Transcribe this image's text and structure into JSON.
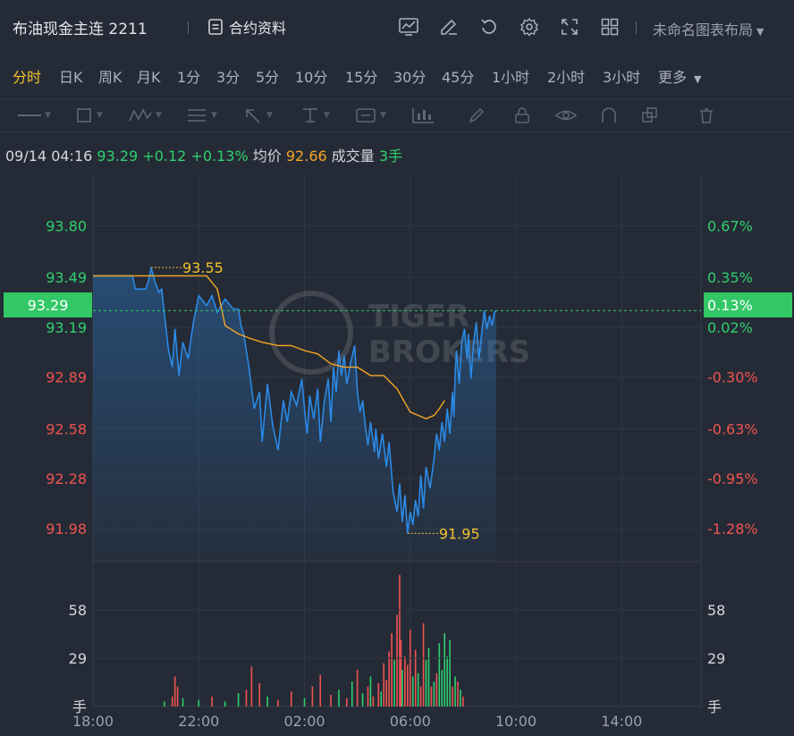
{
  "header": {
    "title": "布油现金主连 2211",
    "info_label": "合约资料",
    "layout_label": "未命名图表布局"
  },
  "periods": [
    "分时",
    "日K",
    "周K",
    "月K",
    "1分",
    "3分",
    "5分",
    "10分",
    "15分",
    "30分",
    "45分",
    "1小时",
    "2小时",
    "3小时",
    "更多"
  ],
  "active_period": "分时",
  "quote": {
    "datetime": "09/14 04:16",
    "price": "93.29",
    "change": "+0.12",
    "change_pct": "+0.13%",
    "avg_label": "均价",
    "avg_value": "92.66",
    "volume_label": "成交量",
    "volume_value": "3手"
  },
  "current_price_badge": "93.29",
  "current_pct_badge": "0.13%",
  "watermark": [
    "TIGER",
    "BROKERS"
  ],
  "colors": {
    "up": "#2fcf6d",
    "down": "#ef5350",
    "price_line": "#2b8ae6",
    "avg_line": "#f5a623",
    "annotation": "#f2c230",
    "active_tab": "#f2c230"
  },
  "chart_data": {
    "type": "line",
    "time_axis": {
      "labels": [
        "18:00",
        "22:00",
        "02:00",
        "06:00",
        "10:00",
        "14:00"
      ],
      "session_start": "18:00",
      "session_hours": 23
    },
    "price_axis": {
      "ticks": [
        "93.80",
        "93.49",
        "93.19",
        "92.89",
        "92.58",
        "92.28",
        "91.98"
      ],
      "pct_ticks": [
        "0.67%",
        "0.35%",
        "0.02%",
        "-0.30%",
        "-0.63%",
        "-0.95%",
        "-1.28%"
      ],
      "prev_close": 93.17,
      "range": [
        91.78,
        94.11
      ]
    },
    "series": [
      {
        "name": "price",
        "x_hours": [
          0,
          1.0,
          1.5,
          1.6,
          2.0,
          2.15,
          2.2,
          2.35,
          2.5,
          2.6,
          2.7,
          2.85,
          3.0,
          3.1,
          3.25,
          3.4,
          3.6,
          3.8,
          4.0,
          4.3,
          4.5,
          4.7,
          5.0,
          5.3,
          5.5,
          5.6,
          5.7,
          5.75,
          5.9,
          6.1,
          6.3,
          6.4,
          6.6,
          6.8,
          7.0,
          7.2,
          7.35,
          7.5,
          7.7,
          7.9,
          8.0,
          8.1,
          8.2,
          8.35,
          8.5,
          8.6,
          8.75,
          8.9,
          9.0,
          9.1,
          9.2,
          9.3,
          9.4,
          9.5,
          9.6,
          9.75,
          9.9,
          10.0,
          10.1,
          10.2,
          10.3,
          10.4,
          10.5,
          10.65,
          10.7,
          10.8,
          10.95,
          11.1,
          11.2,
          11.35,
          11.5,
          11.6,
          11.7,
          11.8,
          11.9,
          12.0,
          12.1,
          12.2,
          12.3,
          12.4,
          12.5,
          12.6,
          12.75,
          12.9,
          13.0,
          13.1,
          13.2,
          13.3,
          13.4,
          13.5,
          13.6,
          13.65,
          13.7,
          13.75,
          13.85,
          13.95,
          14.05,
          14.15,
          14.2,
          14.3,
          14.4,
          14.5,
          14.6,
          14.7,
          14.8,
          14.9,
          15.0,
          15.1,
          15.18,
          15.25
        ],
        "values": [
          93.5,
          93.5,
          93.5,
          93.42,
          93.42,
          93.5,
          93.55,
          93.46,
          93.4,
          93.42,
          93.27,
          93.06,
          92.95,
          93.18,
          92.9,
          93.1,
          93.0,
          93.22,
          93.38,
          93.32,
          93.38,
          93.28,
          93.36,
          93.3,
          93.3,
          93.2,
          93.15,
          93.1,
          92.95,
          92.7,
          92.8,
          92.5,
          92.85,
          92.6,
          92.45,
          92.75,
          92.62,
          92.8,
          92.72,
          92.88,
          92.7,
          92.55,
          92.78,
          92.64,
          92.82,
          92.5,
          92.74,
          92.88,
          92.62,
          92.95,
          92.8,
          93.05,
          92.9,
          93.02,
          92.85,
          92.98,
          93.08,
          92.8,
          92.68,
          92.75,
          92.6,
          92.48,
          92.62,
          92.44,
          92.58,
          92.4,
          92.55,
          92.35,
          92.5,
          92.2,
          92.08,
          92.25,
          92.02,
          92.18,
          91.95,
          92.08,
          92.0,
          92.15,
          92.05,
          92.3,
          92.1,
          92.35,
          92.22,
          92.4,
          92.55,
          92.45,
          92.62,
          92.5,
          92.7,
          92.55,
          92.8,
          92.65,
          92.9,
          93.05,
          92.85,
          93.1,
          93.18,
          93.0,
          93.15,
          92.88,
          93.1,
          93.22,
          93.0,
          93.15,
          93.29,
          93.18,
          93.26,
          93.2,
          93.28,
          93.29
        ]
      },
      {
        "name": "avg",
        "x_hours": [
          0,
          4.3,
          4.7,
          5.0,
          5.5,
          6.0,
          6.4,
          7.0,
          7.5,
          8.0,
          8.5,
          9.0,
          9.5,
          10.0,
          10.5,
          11.0,
          11.5,
          12.0,
          12.3,
          12.6,
          12.9,
          13.1,
          13.3
        ],
        "values": [
          93.5,
          93.5,
          93.42,
          93.2,
          93.15,
          93.12,
          93.1,
          93.08,
          93.08,
          93.05,
          93.03,
          92.97,
          92.95,
          92.95,
          92.9,
          92.9,
          92.82,
          92.68,
          92.66,
          92.64,
          92.66,
          92.7,
          92.75
        ]
      }
    ],
    "annotations": [
      {
        "label": "93.55",
        "x_hours": 2.2,
        "value": 93.55
      },
      {
        "label": "91.95",
        "x_hours": 11.9,
        "value": 91.95
      }
    ],
    "volume": {
      "unit": "手",
      "ticks": [
        "58",
        "29"
      ],
      "max": 87,
      "bars": [
        {
          "x_hours": 2.7,
          "v": 3,
          "up": true
        },
        {
          "x_hours": 3.0,
          "v": 6,
          "up": false
        },
        {
          "x_hours": 3.1,
          "v": 18,
          "up": false
        },
        {
          "x_hours": 3.2,
          "v": 12,
          "up": false
        },
        {
          "x_hours": 3.4,
          "v": 5,
          "up": true
        },
        {
          "x_hours": 4.0,
          "v": 4,
          "up": true
        },
        {
          "x_hours": 4.5,
          "v": 6,
          "up": false
        },
        {
          "x_hours": 5.0,
          "v": 3,
          "up": true
        },
        {
          "x_hours": 5.5,
          "v": 8,
          "up": true
        },
        {
          "x_hours": 5.8,
          "v": 10,
          "up": false
        },
        {
          "x_hours": 6.0,
          "v": 24,
          "up": false
        },
        {
          "x_hours": 6.3,
          "v": 14,
          "up": false
        },
        {
          "x_hours": 6.6,
          "v": 6,
          "up": true
        },
        {
          "x_hours": 7.0,
          "v": 4,
          "up": false
        },
        {
          "x_hours": 7.5,
          "v": 9,
          "up": false
        },
        {
          "x_hours": 8.0,
          "v": 5,
          "up": true
        },
        {
          "x_hours": 8.3,
          "v": 12,
          "up": false
        },
        {
          "x_hours": 8.6,
          "v": 19,
          "up": false
        },
        {
          "x_hours": 9.0,
          "v": 7,
          "up": false
        },
        {
          "x_hours": 9.3,
          "v": 10,
          "up": true
        },
        {
          "x_hours": 9.6,
          "v": 5,
          "up": false
        },
        {
          "x_hours": 9.8,
          "v": 15,
          "up": true
        },
        {
          "x_hours": 10.0,
          "v": 22,
          "up": false
        },
        {
          "x_hours": 10.2,
          "v": 8,
          "up": true
        },
        {
          "x_hours": 10.4,
          "v": 12,
          "up": false
        },
        {
          "x_hours": 10.5,
          "v": 18,
          "up": true
        },
        {
          "x_hours": 10.6,
          "v": 6,
          "up": false
        },
        {
          "x_hours": 10.8,
          "v": 14,
          "up": false
        },
        {
          "x_hours": 10.9,
          "v": 9,
          "up": true
        },
        {
          "x_hours": 11.0,
          "v": 26,
          "up": false
        },
        {
          "x_hours": 11.1,
          "v": 16,
          "up": false
        },
        {
          "x_hours": 11.2,
          "v": 33,
          "up": false
        },
        {
          "x_hours": 11.3,
          "v": 44,
          "up": false
        },
        {
          "x_hours": 11.4,
          "v": 28,
          "up": true
        },
        {
          "x_hours": 11.5,
          "v": 55,
          "up": false
        },
        {
          "x_hours": 11.6,
          "v": 79,
          "up": false
        },
        {
          "x_hours": 11.65,
          "v": 40,
          "up": false
        },
        {
          "x_hours": 11.7,
          "v": 22,
          "up": true
        },
        {
          "x_hours": 11.8,
          "v": 30,
          "up": false
        },
        {
          "x_hours": 11.9,
          "v": 25,
          "up": false
        },
        {
          "x_hours": 12.0,
          "v": 46,
          "up": false
        },
        {
          "x_hours": 12.1,
          "v": 18,
          "up": true
        },
        {
          "x_hours": 12.2,
          "v": 34,
          "up": false
        },
        {
          "x_hours": 12.3,
          "v": 20,
          "up": true
        },
        {
          "x_hours": 12.4,
          "v": 12,
          "up": false
        },
        {
          "x_hours": 12.5,
          "v": 50,
          "up": false
        },
        {
          "x_hours": 12.6,
          "v": 28,
          "up": true
        },
        {
          "x_hours": 12.7,
          "v": 35,
          "up": true
        },
        {
          "x_hours": 12.8,
          "v": 12,
          "up": false
        },
        {
          "x_hours": 12.9,
          "v": 15,
          "up": true
        },
        {
          "x_hours": 13.0,
          "v": 20,
          "up": false
        },
        {
          "x_hours": 13.1,
          "v": 38,
          "up": true
        },
        {
          "x_hours": 13.2,
          "v": 22,
          "up": true
        },
        {
          "x_hours": 13.3,
          "v": 44,
          "up": true
        },
        {
          "x_hours": 13.4,
          "v": 30,
          "up": true
        },
        {
          "x_hours": 13.5,
          "v": 40,
          "up": true
        },
        {
          "x_hours": 13.6,
          "v": 12,
          "up": false
        },
        {
          "x_hours": 13.7,
          "v": 18,
          "up": true
        },
        {
          "x_hours": 13.8,
          "v": 15,
          "up": false
        },
        {
          "x_hours": 13.9,
          "v": 10,
          "up": true
        },
        {
          "x_hours": 14.0,
          "v": 6,
          "up": false
        }
      ]
    }
  }
}
